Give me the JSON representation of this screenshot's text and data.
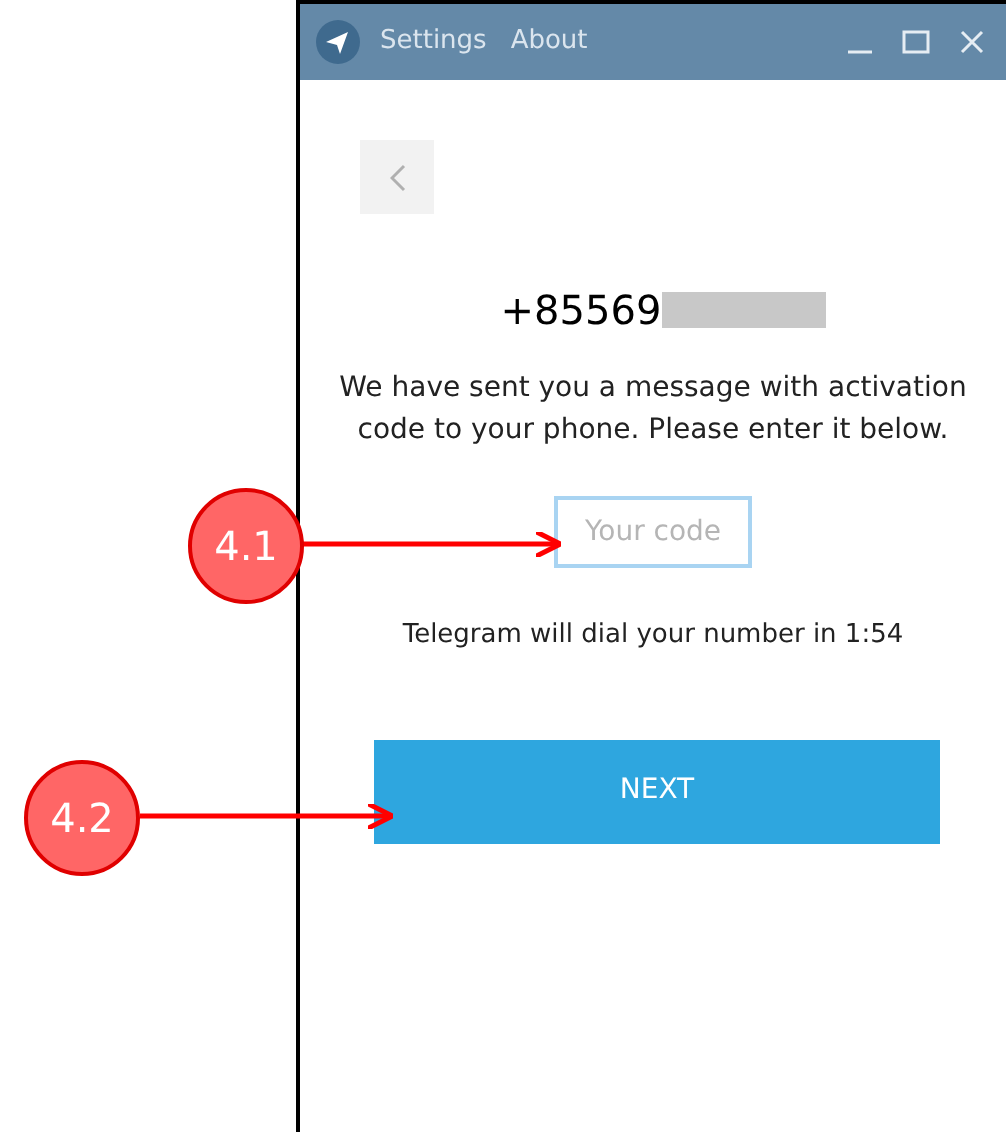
{
  "window": {
    "menu": [
      "Settings",
      "About"
    ]
  },
  "phone": "+85569",
  "message": "We have sent you a message with activation code to your phone. Please enter it below.",
  "code_field": {
    "placeholder": "Your code"
  },
  "dial_notice": "Telegram will dial your number in 1:54",
  "next_button": "NEXT",
  "callouts": [
    {
      "label": "4.1"
    },
    {
      "label": "4.2"
    }
  ]
}
